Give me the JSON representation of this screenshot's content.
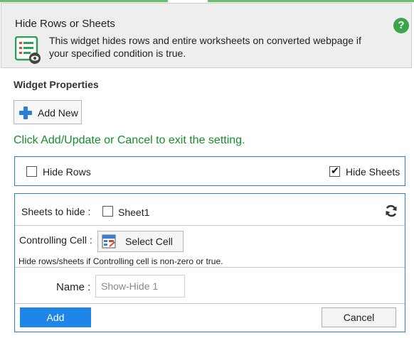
{
  "header": {
    "title": "Hide Rows or Sheets",
    "description": "This widget hides rows and entire worksheets on converted webpage if your specified condition is true.",
    "help_symbol": "?"
  },
  "properties": {
    "section_title": "Widget Properties",
    "add_new_label": "Add New",
    "hint": "Click Add/Update or Cancel to exit the setting."
  },
  "options": {
    "hide_rows": {
      "label": "Hide Rows",
      "checked": false
    },
    "hide_sheets": {
      "label": "Hide Sheets",
      "checked": true
    }
  },
  "form": {
    "sheets_label": "Sheets to hide :",
    "sheets": [
      {
        "name": "Sheet1",
        "checked": false
      }
    ],
    "controlling_label": "Controlling Cell :",
    "select_cell_label": "Select Cell",
    "note": "Hide rows/sheets if Controlling cell is non-zero or true.",
    "name_label": "Name :",
    "name_value": "Show-Hide 1",
    "add_label": "Add",
    "cancel_label": "Cancel"
  },
  "colors": {
    "accent_blue": "#1e86e8",
    "border_blue": "#2f7fd0",
    "hint_green": "#1a8a2e",
    "help_green": "#3aa54a"
  },
  "icons": [
    "widget-list-eye-icon",
    "help-icon",
    "plus-icon",
    "refresh-icon",
    "select-cell-icon"
  ]
}
